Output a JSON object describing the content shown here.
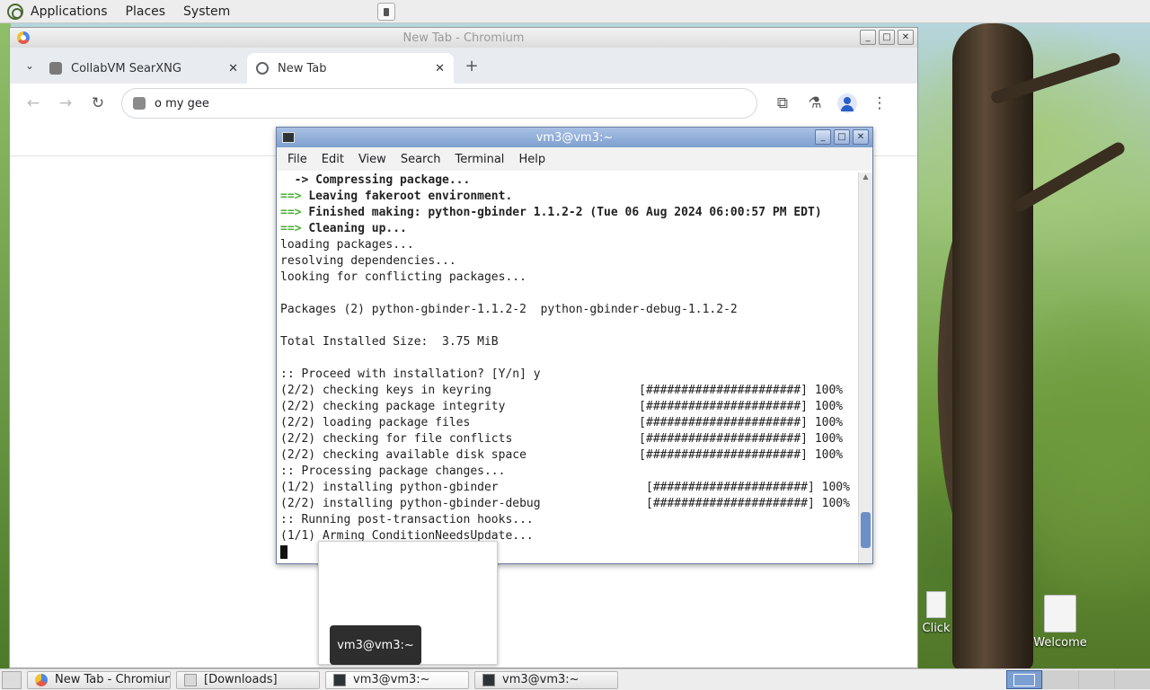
{
  "top_panel": {
    "menus": [
      "Applications",
      "Places",
      "System"
    ]
  },
  "chromium": {
    "window_title": "New Tab - Chromium",
    "tabs": [
      {
        "label": "CollabVM SearXNG",
        "active": false
      },
      {
        "label": "New Tab",
        "active": true
      }
    ],
    "omnibox_value": "o my gee"
  },
  "terminal": {
    "window_title": "vm3@vm3:~",
    "menu": [
      "File",
      "Edit",
      "View",
      "Search",
      "Terminal",
      "Help"
    ],
    "lines": [
      {
        "prefix": "  -> ",
        "text": "Compressing package...",
        "bold": true,
        "arrow": false
      },
      {
        "prefix": "==> ",
        "text": "Leaving fakeroot environment.",
        "bold": true,
        "arrow": true
      },
      {
        "prefix": "==> ",
        "text": "Finished making: python-gbinder 1.1.2-2 (Tue 06 Aug 2024 06:00:57 PM EDT)",
        "bold": true,
        "arrow": true
      },
      {
        "prefix": "==> ",
        "text": "Cleaning up...",
        "bold": true,
        "arrow": true
      },
      {
        "prefix": "",
        "text": "loading packages...",
        "bold": false,
        "arrow": false
      },
      {
        "prefix": "",
        "text": "resolving dependencies...",
        "bold": false,
        "arrow": false
      },
      {
        "prefix": "",
        "text": "looking for conflicting packages...",
        "bold": false,
        "arrow": false
      },
      {
        "prefix": "",
        "text": "",
        "bold": false,
        "arrow": false
      },
      {
        "prefix": "",
        "text": "Packages (2) python-gbinder-1.1.2-2  python-gbinder-debug-1.1.2-2",
        "bold": false,
        "arrow": false
      },
      {
        "prefix": "",
        "text": "",
        "bold": false,
        "arrow": false
      },
      {
        "prefix": "",
        "text": "Total Installed Size:  3.75 MiB",
        "bold": false,
        "arrow": false
      },
      {
        "prefix": "",
        "text": "",
        "bold": false,
        "arrow": false
      },
      {
        "prefix": "",
        "text": ":: Proceed with installation? [Y/n] y",
        "bold": false,
        "arrow": false
      },
      {
        "prefix": "",
        "text": "(2/2) checking keys in keyring                     [######################] 100%",
        "bold": false,
        "arrow": false
      },
      {
        "prefix": "",
        "text": "(2/2) checking package integrity                   [######################] 100%",
        "bold": false,
        "arrow": false
      },
      {
        "prefix": "",
        "text": "(2/2) loading package files                        [######################] 100%",
        "bold": false,
        "arrow": false
      },
      {
        "prefix": "",
        "text": "(2/2) checking for file conflicts                  [######################] 100%",
        "bold": false,
        "arrow": false
      },
      {
        "prefix": "",
        "text": "(2/2) checking available disk space                [######################] 100%",
        "bold": false,
        "arrow": false
      },
      {
        "prefix": "",
        "text": ":: Processing package changes...",
        "bold": false,
        "arrow": false
      },
      {
        "prefix": "",
        "text": "(1/2) installing python-gbinder                     [######################] 100%",
        "bold": false,
        "arrow": false
      },
      {
        "prefix": "",
        "text": "(2/2) installing python-gbinder-debug               [######################] 100%",
        "bold": false,
        "arrow": false
      },
      {
        "prefix": "",
        "text": ":: Running post-transaction hooks...",
        "bold": false,
        "arrow": false
      },
      {
        "prefix": "",
        "text": "(1/1) Arming ConditionNeedsUpdate...",
        "bold": false,
        "arrow": false
      }
    ]
  },
  "preview_tooltip": "vm3@vm3:~",
  "desktop_icons": [
    {
      "label": "Click"
    },
    {
      "label": "Welcome"
    }
  ],
  "taskbar": [
    {
      "label": "New Tab - Chromium",
      "icon": "chromium-icon"
    },
    {
      "label": "[Downloads]",
      "icon": "folder-icon"
    },
    {
      "label": "vm3@vm3:~",
      "icon": "terminal-icon",
      "active": true
    },
    {
      "label": "vm3@vm3:~",
      "icon": "terminal-icon"
    }
  ]
}
